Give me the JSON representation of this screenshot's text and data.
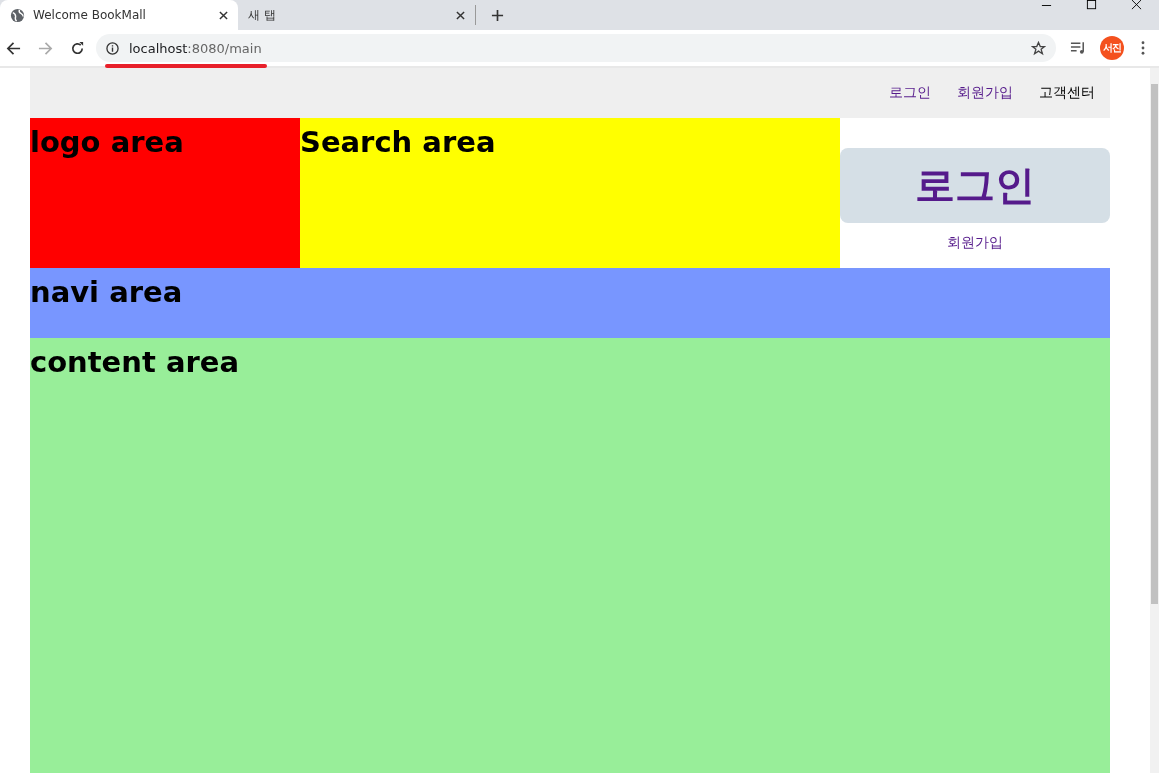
{
  "browser": {
    "tabs": [
      {
        "title": "Welcome BookMall",
        "selected": true
      },
      {
        "title": "새 탭",
        "selected": false
      }
    ],
    "address": {
      "host": "localhost",
      "path": ":8080/main"
    },
    "profile": "서진"
  },
  "top_links": [
    {
      "label": "로그인",
      "visited": true
    },
    {
      "label": "회원가입",
      "visited": true
    },
    {
      "label": "고객센터",
      "visited": false
    }
  ],
  "header": {
    "logo_area": "logo area",
    "search_area": "Search area",
    "login_button": "로그인",
    "signup_link": "회원가입"
  },
  "navi_area": "navi area",
  "content_area": "content area"
}
